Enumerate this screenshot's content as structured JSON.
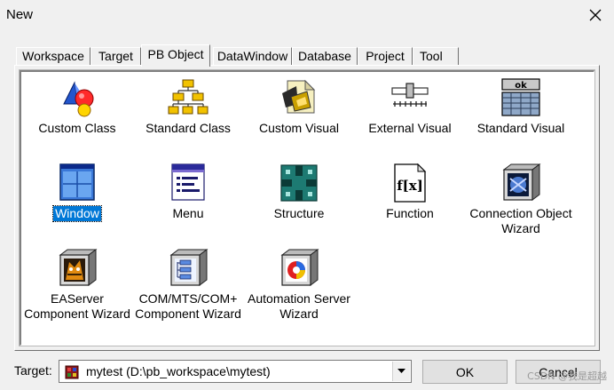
{
  "window": {
    "title": "New"
  },
  "tabs": [
    {
      "label": "Workspace"
    },
    {
      "label": "Target"
    },
    {
      "label": "PB Object"
    },
    {
      "label": "DataWindow"
    },
    {
      "label": "Database"
    },
    {
      "label": "Project"
    },
    {
      "label": "Tool"
    }
  ],
  "active_tab": "PB Object",
  "items": [
    {
      "label": "Custom Class",
      "icon": "custom-class-icon"
    },
    {
      "label": "Standard Class",
      "icon": "standard-class-icon"
    },
    {
      "label": "Custom Visual",
      "icon": "custom-visual-icon"
    },
    {
      "label": "External Visual",
      "icon": "external-visual-icon"
    },
    {
      "label": "Standard Visual",
      "icon": "standard-visual-icon",
      "icon_text": "ok"
    },
    {
      "label": "Window",
      "icon": "window-icon",
      "selected": true
    },
    {
      "label": "Menu",
      "icon": "menu-icon"
    },
    {
      "label": "Structure",
      "icon": "structure-icon"
    },
    {
      "label": "Function",
      "icon": "function-icon",
      "icon_text": "f[x]"
    },
    {
      "label_lines": [
        "Connection Object",
        "Wizard"
      ],
      "icon": "connection-wizard-icon"
    },
    {
      "label_lines": [
        "EAServer",
        "Component Wizard"
      ],
      "icon": "easerver-wizard-icon"
    },
    {
      "label_lines": [
        "COM/MTS/COM+",
        "Component Wizard"
      ],
      "icon": "com-wizard-icon"
    },
    {
      "label_lines": [
        "Automation Server",
        "Wizard"
      ],
      "icon": "automation-wizard-icon"
    }
  ],
  "footer": {
    "target_label": "Target:",
    "target_value": "mytest (D:\\pb_workspace\\mytest)",
    "ok_label": "OK",
    "cancel_label": "Cancel"
  },
  "watermark": "CSDN @我是超越",
  "colors": {
    "selection": "#0078d7",
    "background": "#f0f0f0"
  }
}
